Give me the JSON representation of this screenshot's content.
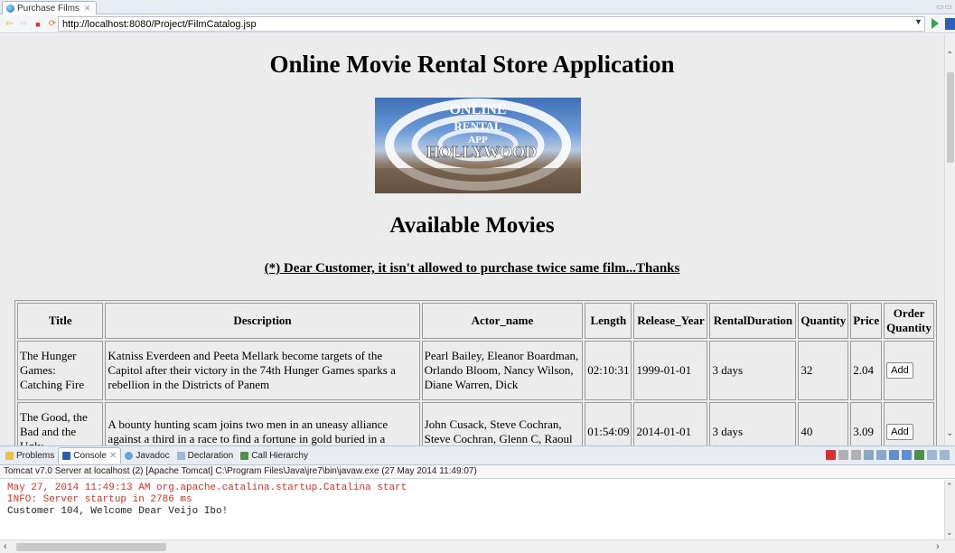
{
  "editor_tab": {
    "label": "Purchase Films",
    "close_glyph": "✕"
  },
  "browser": {
    "url": "http://localhost:8080/Project/FilmCatalog.jsp",
    "icons": [
      "back-arrow-icon",
      "forward-arrow-icon",
      "stop-icon",
      "refresh-icon",
      "dropdown-icon",
      "go-icon"
    ]
  },
  "page": {
    "title": "Online Movie Rental Store Application",
    "logo_text": [
      "ONLINE",
      "RENTAL",
      "APP",
      "HOLLYWOOD"
    ],
    "section_title": "Available Movies",
    "notice": "(*) Dear Customer, it isn't allowed to purchase twice same film...Thanks",
    "table": {
      "headers": [
        "Title",
        "Description",
        "Actor_name",
        "Length",
        "Release_Year",
        "RentalDuration",
        "Quantity",
        "Price",
        "Order Quantity"
      ],
      "rows": [
        {
          "title": "The Hunger Games: Catching Fire",
          "description": "Katniss Everdeen and Peeta Mellark become targets of the Capitol after their victory in the 74th Hunger Games sparks a rebellion in the Districts of Panem",
          "actors": "Pearl Bailey, Eleanor Boardman, Orlando Bloom, Nancy Wilson, Diane Warren, Dick",
          "length": "02:10:31",
          "release_year": "1999-01-01",
          "rental_duration": "3 days",
          "quantity": "32",
          "price": "2.04",
          "button": "Add"
        },
        {
          "title": "The Good, the Bad and the Ugly",
          "description": "A bounty hunting scam joins two men in an uneasy alliance against a third in a race to find a fortune in gold buried in a",
          "actors": "John Cusack, Steve Cochran, Steve Cochran, Glenn C, Raoul",
          "length": "01:54:09",
          "release_year": "2014-01-01",
          "rental_duration": "3 days",
          "quantity": "40",
          "price": "3.09",
          "button": "Add"
        }
      ]
    }
  },
  "bottom_panel": {
    "tabs": [
      {
        "label": "Problems",
        "icon": "problems-icon"
      },
      {
        "label": "Console",
        "icon": "console-icon",
        "active": true
      },
      {
        "label": "Javadoc",
        "icon": "javadoc-icon"
      },
      {
        "label": "Declaration",
        "icon": "declaration-icon"
      },
      {
        "label": "Call Hierarchy",
        "icon": "call-hierarchy-icon"
      }
    ],
    "console_title": "Tomcat v7.0 Server at localhost (2) [Apache Tomcat] C:\\Program Files\\Java\\jre7\\bin\\javaw.exe (27 May 2014 11:49:07)",
    "console_lines": [
      {
        "text": "May 27, 2014 11:49:13 AM org.apache.catalina.startup.Catalina start",
        "kind": "err"
      },
      {
        "text": "INFO: Server startup in 2786 ms",
        "kind": "err"
      },
      {
        "text": "Customer 104,  Welcome Dear Veijo Ibo!",
        "kind": "out"
      }
    ]
  },
  "colors": {
    "console_error": "#e0301e",
    "page_bg": "#ececec",
    "go_green": "#2fa84a",
    "stop_red": "#d93030"
  }
}
